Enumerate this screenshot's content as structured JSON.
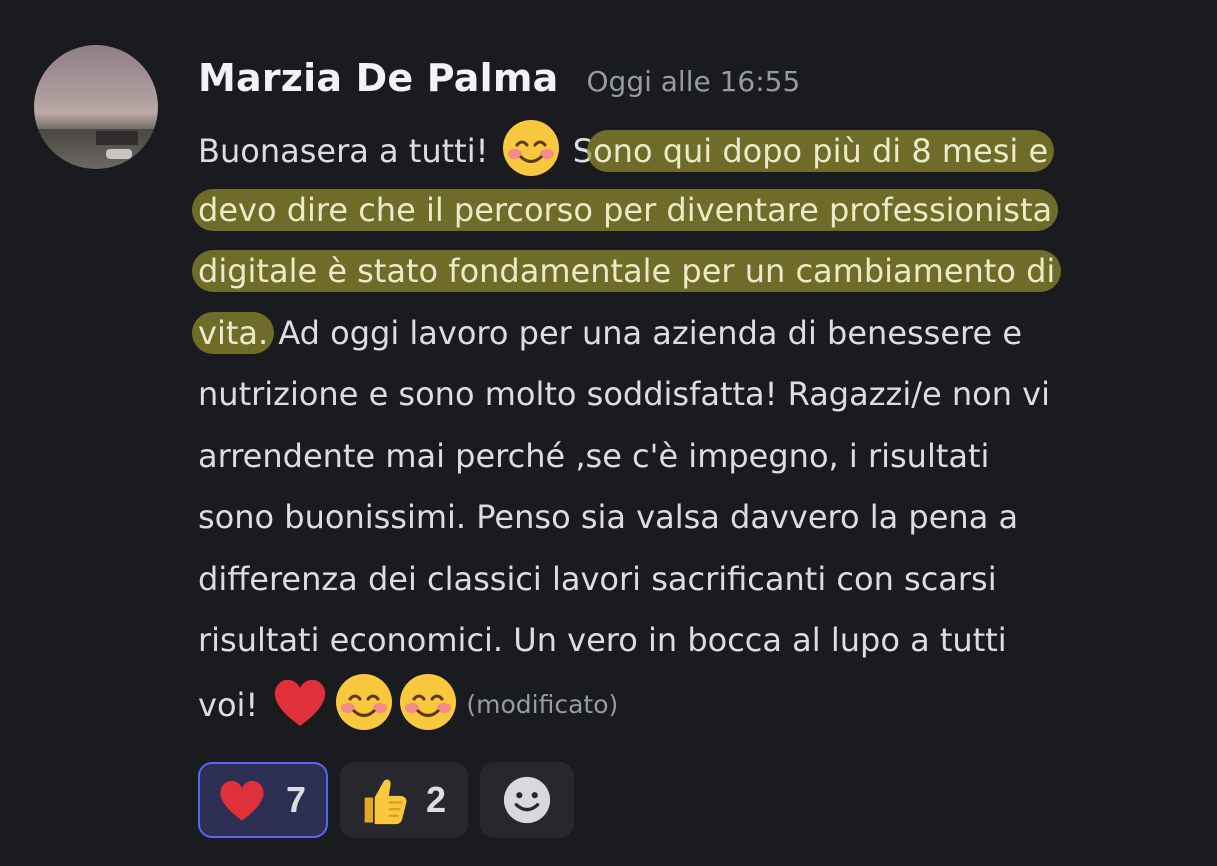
{
  "message": {
    "author": "Marzia De Palma",
    "timestamp": "Oggi alle 16:55",
    "lines": [
      {
        "pre": "Buonasera a tutti! ",
        "emoji": "smiling-blushing-emoji",
        "mid": " S",
        "hl": "ono qui dopo più di 8 mesi e"
      },
      {
        "hl": "devo dire che il percorso per diventare professionista"
      },
      {
        "hl": "digitale è stato fondamentale per un cambiamento di"
      },
      {
        "hl": "vita.",
        "post": " Ad oggi lavoro per una azienda di benessere e"
      },
      {
        "text": "nutrizione e sono molto soddisfatta! Ragazzi/e non vi"
      },
      {
        "text": "arrendente mai perché ,se c'è impegno, i risultati"
      },
      {
        "text": "sono buonissimi. Penso sia valsa davvero la pena a"
      },
      {
        "text": "differenza dei classici lavori sacrificanti con scarsi"
      },
      {
        "text": "risultati economici. Un vero in bocca al lupo a tutti"
      },
      {
        "pre": "voi! "
      }
    ],
    "edited_label": "(modificato)",
    "end_emojis": [
      "heart-emoji",
      "smiling-blushing-emoji",
      "smiling-blushing-emoji"
    ]
  },
  "reactions": [
    {
      "icon": "heart-emoji",
      "count": "7",
      "active": true
    },
    {
      "icon": "thumbs-up-emoji",
      "count": "2",
      "active": false
    },
    {
      "icon": "add-reaction-icon"
    }
  ],
  "colors": {
    "background": "#1a1b1f",
    "text": "#dbdee1",
    "muted": "#949ba4",
    "highlight": "#8f8c2d",
    "reaction_active_border": "#5865f2"
  }
}
